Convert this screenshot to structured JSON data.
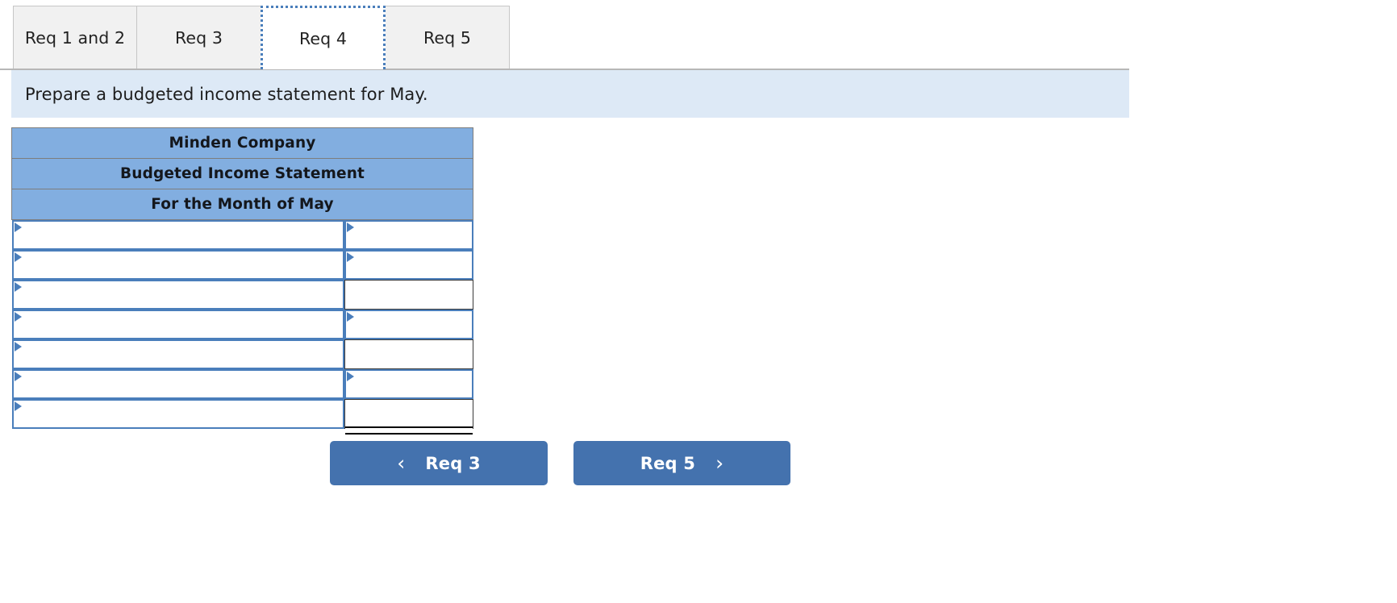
{
  "tabs": [
    {
      "label": "Req 1 and 2",
      "active": false
    },
    {
      "label": "Req 3",
      "active": false
    },
    {
      "label": "Req 4",
      "active": true
    },
    {
      "label": "Req 5",
      "active": false
    }
  ],
  "instruction": {
    "text": "Prepare a budgeted income statement for May."
  },
  "statement": {
    "headers": [
      "Minden Company",
      "Budgeted Income Statement",
      "For the Month of May"
    ],
    "rows": [
      {
        "label": {
          "kind": "dropdown",
          "value": ""
        },
        "value": {
          "kind": "dropdown",
          "value": ""
        }
      },
      {
        "label": {
          "kind": "dropdown",
          "value": ""
        },
        "value": {
          "kind": "dropdown",
          "value": ""
        }
      },
      {
        "label": {
          "kind": "dropdown",
          "value": ""
        },
        "value": {
          "kind": "plain",
          "value": ""
        }
      },
      {
        "label": {
          "kind": "dropdown",
          "value": ""
        },
        "value": {
          "kind": "dropdown",
          "value": ""
        }
      },
      {
        "label": {
          "kind": "dropdown",
          "value": ""
        },
        "value": {
          "kind": "plain",
          "value": ""
        }
      },
      {
        "label": {
          "kind": "dropdown",
          "value": ""
        },
        "value": {
          "kind": "dropdown",
          "value": ""
        }
      },
      {
        "label": {
          "kind": "dropdown",
          "value": ""
        },
        "value": {
          "kind": "plain",
          "value": "",
          "total": true
        }
      }
    ]
  },
  "nav": {
    "prev_label": "Req 3",
    "prev_icon": "chevron-left-icon",
    "prev_glyph": "‹",
    "next_label": "Req 5",
    "next_icon": "chevron-right-icon",
    "next_glyph": "›"
  },
  "colors": {
    "tab_active_border": "#4a7ebb",
    "tab_inactive_bg": "#f1f1f1",
    "instruction_bg": "#dde9f6",
    "header_bg": "#82aee0",
    "cell_border": "#4a7ebb",
    "button_bg": "#4472ae"
  }
}
